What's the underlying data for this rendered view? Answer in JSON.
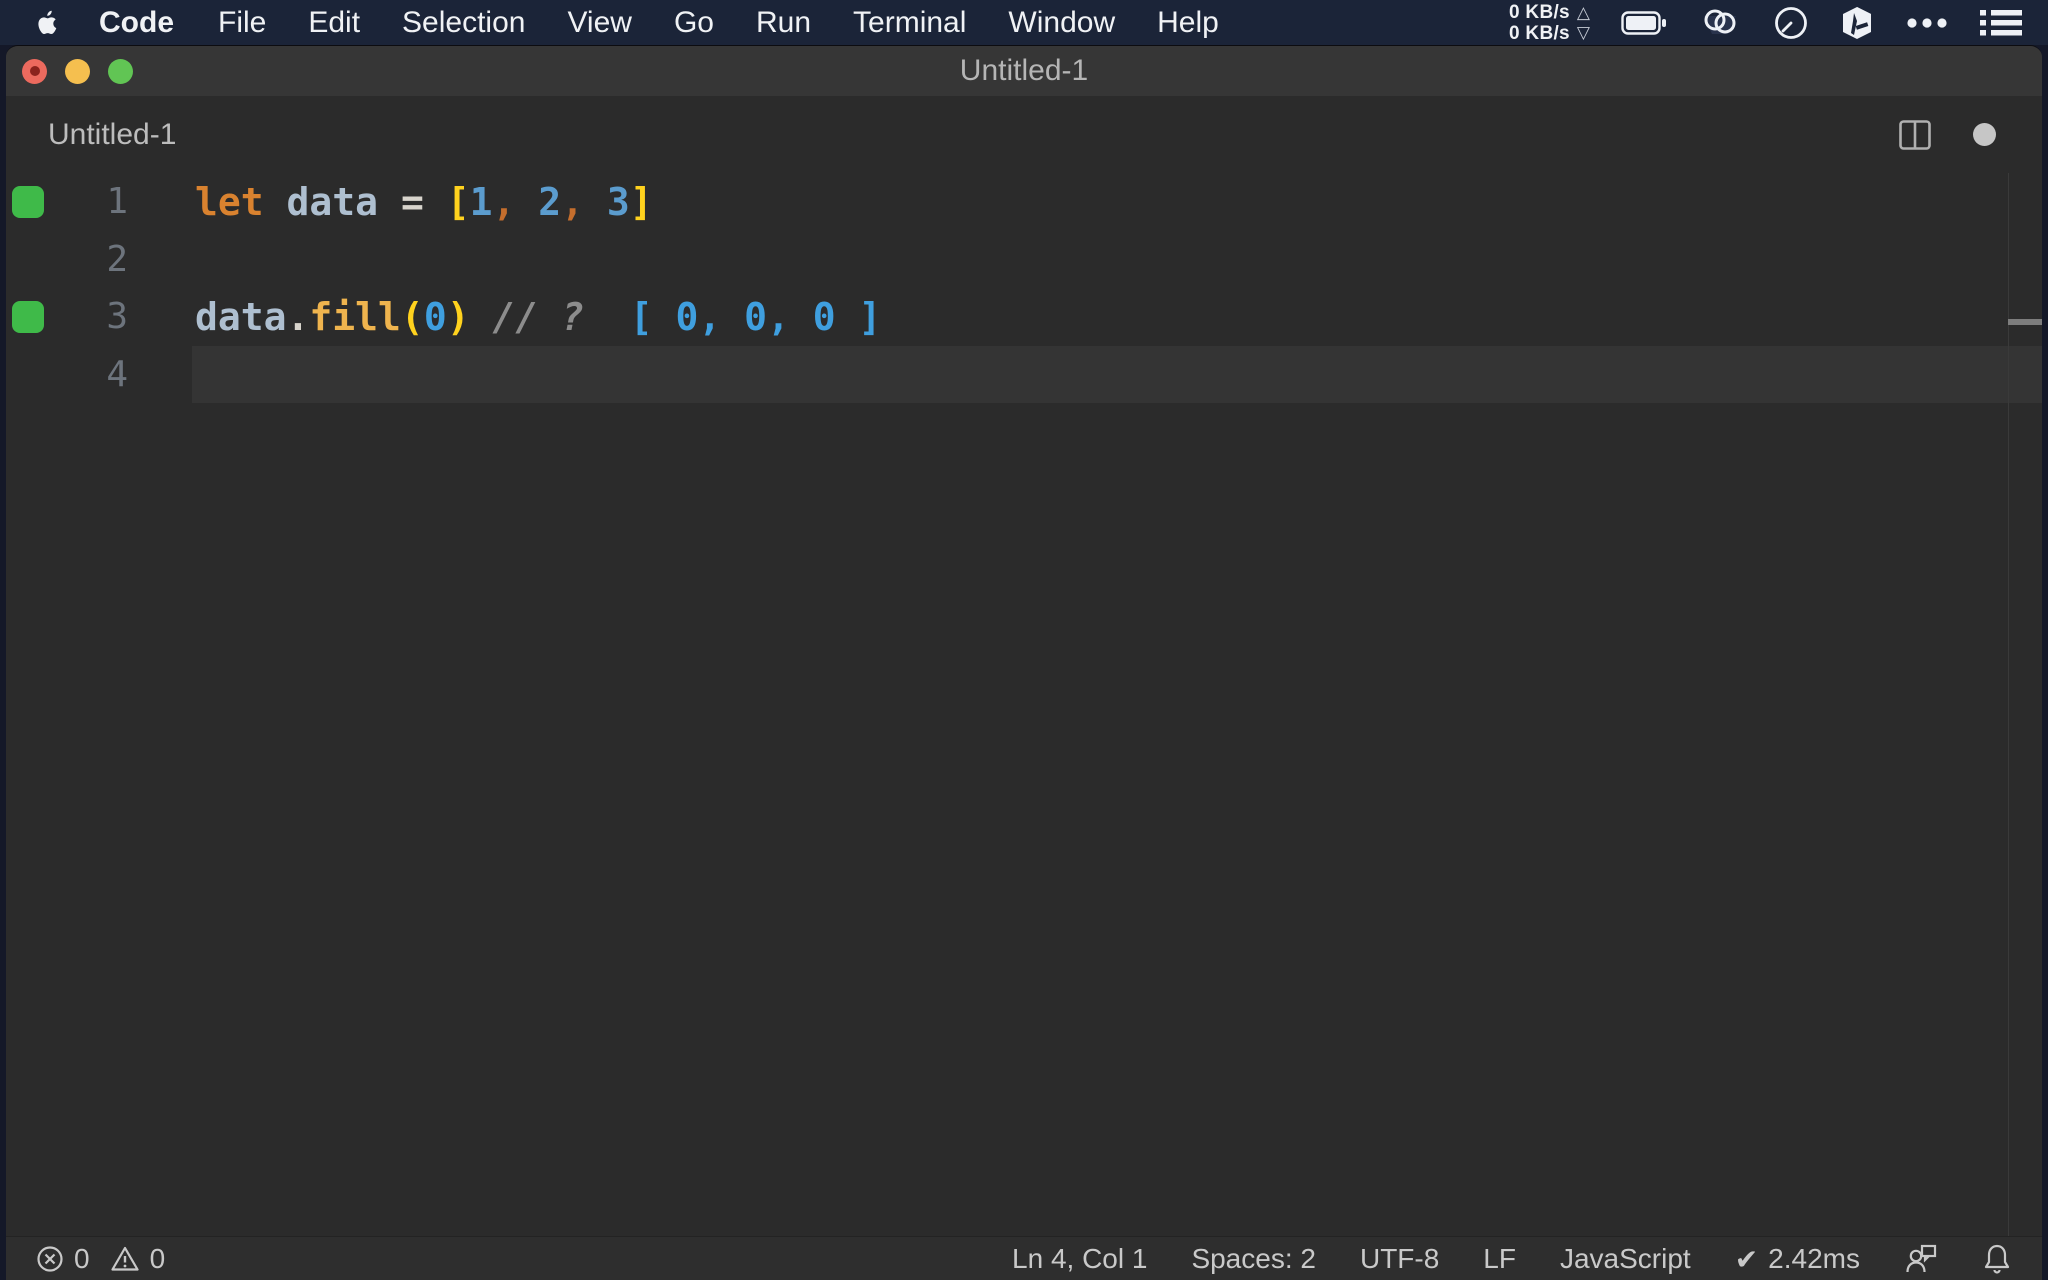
{
  "colors": {
    "desktop_bg": "#141828",
    "menubar_bg": "#1b2438",
    "titlebar_bg": "#363636",
    "tabrow_bg": "#2b2b2b",
    "editor_bg": "#2b2b2b",
    "current_line_bg": "#343434",
    "statusbar_bg": "#2e2e2e",
    "traffic_red": "#ec6a5e",
    "traffic_yellow": "#f5bf4f",
    "traffic_green": "#61c554",
    "coverage_green": "#3fba49",
    "line_number": "#6d747d"
  },
  "menu_bar": {
    "items": [
      {
        "label": "Code",
        "bold": true
      },
      {
        "label": "File"
      },
      {
        "label": "Edit"
      },
      {
        "label": "Selection"
      },
      {
        "label": "View"
      },
      {
        "label": "Go"
      },
      {
        "label": "Run"
      },
      {
        "label": "Terminal"
      },
      {
        "label": "Window"
      },
      {
        "label": "Help"
      }
    ],
    "network": {
      "up": "0 KB/s",
      "down": "0 KB/s",
      "up_arrow": "△",
      "down_arrow": "▽"
    }
  },
  "window": {
    "title": "Untitled-1",
    "tab_label": "Untitled-1"
  },
  "editor": {
    "palette": {
      "keyword": "#d9822f",
      "variable": "#aebfd0",
      "operator": "#d8d4cc",
      "bracket": "#ffd21e",
      "number": "#5b9cce",
      "comma": "#c56e2d",
      "method": "#efb44e",
      "comment": "#8c8c8c",
      "result": "#3f9fdf",
      "plain": "#d4d4d4"
    },
    "lines": [
      {
        "number": "1",
        "marker": true,
        "tokens": [
          {
            "t": "let",
            "c": "keyword"
          },
          {
            "t": " ",
            "c": "plain"
          },
          {
            "t": "data",
            "c": "variable"
          },
          {
            "t": " ",
            "c": "plain"
          },
          {
            "t": "=",
            "c": "operator"
          },
          {
            "t": " ",
            "c": "plain"
          },
          {
            "t": "[",
            "c": "bracket"
          },
          {
            "t": "1",
            "c": "number"
          },
          {
            "t": ", ",
            "c": "comma"
          },
          {
            "t": "2",
            "c": "number"
          },
          {
            "t": ", ",
            "c": "comma"
          },
          {
            "t": "3",
            "c": "number"
          },
          {
            "t": "]",
            "c": "bracket"
          }
        ]
      },
      {
        "number": "2",
        "marker": false,
        "tokens": []
      },
      {
        "number": "3",
        "marker": true,
        "tokens": [
          {
            "t": "data",
            "c": "variable"
          },
          {
            "t": ".",
            "c": "operator"
          },
          {
            "t": "fill",
            "c": "method"
          },
          {
            "t": "(",
            "c": "bracket"
          },
          {
            "t": "0",
            "c": "result"
          },
          {
            "t": ")",
            "c": "bracket"
          },
          {
            "t": " ",
            "c": "plain"
          },
          {
            "t": "// ?",
            "c": "comment",
            "i": true
          },
          {
            "t": "  ",
            "c": "plain"
          },
          {
            "t": "[ 0, 0, 0 ]",
            "c": "result"
          }
        ]
      },
      {
        "number": "4",
        "marker": false,
        "current": true,
        "tokens": []
      }
    ]
  },
  "status_bar": {
    "errors": "0",
    "warnings": "0",
    "cursor": "Ln 4, Col 1",
    "indentation": "Spaces: 2",
    "encoding": "UTF-8",
    "eol": "LF",
    "language": "JavaScript",
    "quokka_check": "✔",
    "quokka_time": "2.42ms"
  }
}
